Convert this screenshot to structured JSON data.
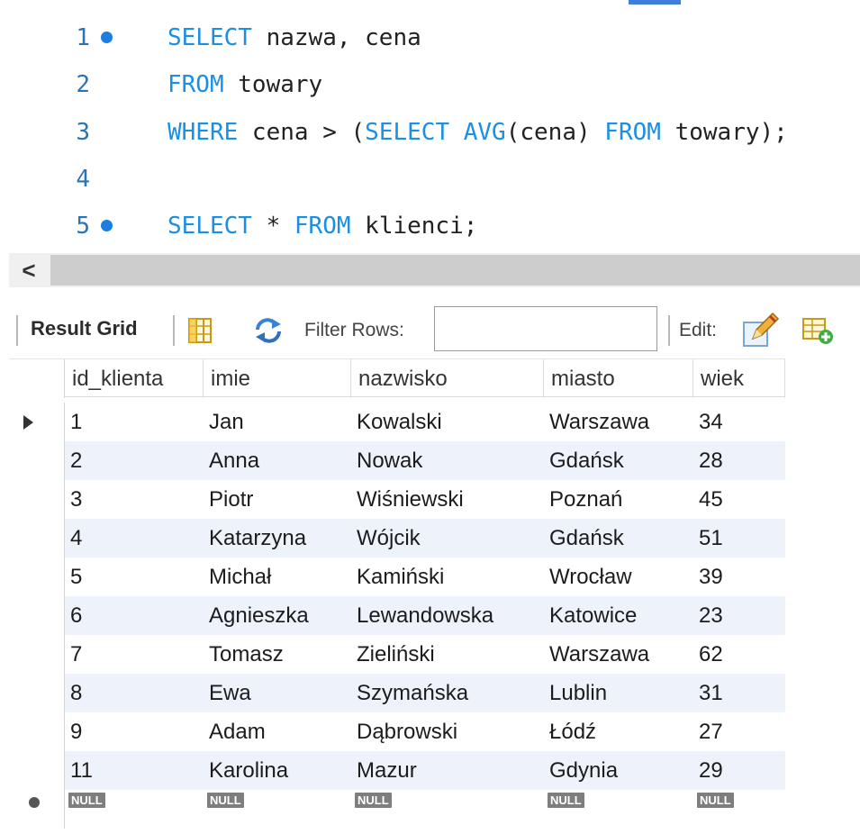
{
  "editor": {
    "lines": [
      {
        "num": "1",
        "breakpoint": true,
        "tokens": [
          {
            "t": "SELECT",
            "kw": true
          },
          {
            "t": " nazwa, cena",
            "kw": false
          }
        ]
      },
      {
        "num": "2",
        "breakpoint": false,
        "tokens": [
          {
            "t": "FROM",
            "kw": true
          },
          {
            "t": " towary",
            "kw": false
          }
        ]
      },
      {
        "num": "3",
        "breakpoint": false,
        "tokens": [
          {
            "t": "WHERE",
            "kw": true
          },
          {
            "t": " cena > (",
            "kw": false
          },
          {
            "t": "SELECT",
            "kw": true
          },
          {
            "t": " ",
            "kw": false
          },
          {
            "t": "AVG",
            "kw": true
          },
          {
            "t": "(cena) ",
            "kw": false
          },
          {
            "t": "FROM",
            "kw": true
          },
          {
            "t": " towary);",
            "kw": false
          }
        ]
      },
      {
        "num": "4",
        "breakpoint": false,
        "tokens": []
      },
      {
        "num": "5",
        "breakpoint": true,
        "tokens": [
          {
            "t": "SELECT",
            "kw": true
          },
          {
            "t": " * ",
            "kw": false
          },
          {
            "t": "FROM",
            "kw": true
          },
          {
            "t": " klienci;",
            "kw": false
          }
        ]
      }
    ],
    "keyword_color": "#1a8fe3",
    "line_number_color": "#2a74b5"
  },
  "scrollbar": {
    "left_arrow": "<"
  },
  "toolbar": {
    "result_grid_label": "Result Grid",
    "filter_label": "Filter Rows:",
    "filter_value": "",
    "edit_label": "Edit:"
  },
  "grid": {
    "columns": [
      "id_klienta",
      "imie",
      "nazwisko",
      "miasto",
      "wiek"
    ],
    "rows": [
      [
        "1",
        "Jan",
        "Kowalski",
        "Warszawa",
        "34"
      ],
      [
        "2",
        "Anna",
        "Nowak",
        "Gdańsk",
        "28"
      ],
      [
        "3",
        "Piotr",
        "Wiśniewski",
        "Poznań",
        "45"
      ],
      [
        "4",
        "Katarzyna",
        "Wójcik",
        "Gdańsk",
        "51"
      ],
      [
        "5",
        "Michał",
        "Kamiński",
        "Wrocław",
        "39"
      ],
      [
        "6",
        "Agnieszka",
        "Lewandowska",
        "Katowice",
        "23"
      ],
      [
        "7",
        "Tomasz",
        "Zieliński",
        "Warszawa",
        "62"
      ],
      [
        "8",
        "Ewa",
        "Szymańska",
        "Lublin",
        "31"
      ],
      [
        "9",
        "Adam",
        "Dąbrowski",
        "Łódź",
        "27"
      ],
      [
        "11",
        "Karolina",
        "Mazur",
        "Gdynia",
        "29"
      ]
    ],
    "null_label": "NULL",
    "zebra_color": "#eef2fb"
  }
}
